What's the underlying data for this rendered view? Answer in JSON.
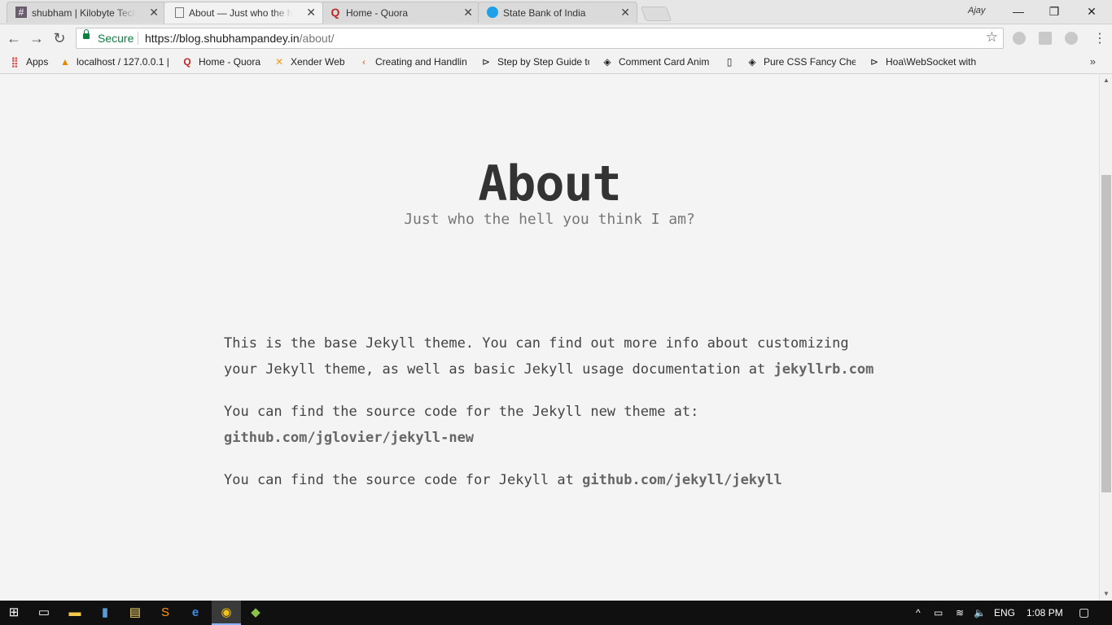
{
  "browser": {
    "tabs": [
      {
        "title": "shubham | Kilobyte Techn",
        "icon": "hash-icon",
        "active": false
      },
      {
        "title": "About — Just who the hell",
        "icon": "page-icon",
        "active": true
      },
      {
        "title": "Home - Quora",
        "icon": "quora-icon",
        "active": false
      },
      {
        "title": "State Bank of India",
        "icon": "sbi-icon",
        "active": false
      }
    ],
    "profile_name": "Ajay",
    "omnibox": {
      "secure_label": "Secure",
      "url_base": "https://blog.shubhampandey.in",
      "url_path": "/about/"
    },
    "bookmarks": [
      {
        "label": "Apps",
        "icon": "apps-grid-icon"
      },
      {
        "label": "localhost / 127.0.0.1 |",
        "icon": "phpmyadmin-icon"
      },
      {
        "label": "Home - Quora",
        "icon": "quora-icon"
      },
      {
        "label": "Xender Web",
        "icon": "xender-icon"
      },
      {
        "label": "Creating and Handlin",
        "icon": "sitepoint-icon"
      },
      {
        "label": "Step by Step Guide to",
        "icon": "codepen-arrow-icon"
      },
      {
        "label": "Comment Card Anim",
        "icon": "codepen-icon"
      },
      {
        "label": "",
        "icon": "blank-page-icon"
      },
      {
        "label": "Pure CSS Fancy Check",
        "icon": "codepen-icon"
      },
      {
        "label": "Hoa\\WebSocket with",
        "icon": "codepen-arrow-icon"
      }
    ]
  },
  "page": {
    "title": "About",
    "subtitle": "Just who the hell you think I am?",
    "p1_text": "This is the base Jekyll theme. You can find out more info about customizing your Jekyll theme, as well as basic Jekyll usage documentation at ",
    "p1_link": "jekyllrb.com",
    "p2_text": "You can find the source code for the Jekyll new theme at: ",
    "p2_link": "github.com/jglovier/jekyll-new",
    "p3_text": "You can find the source code for Jekyll at ",
    "p3_link": "github.com/jekyll/jekyll"
  },
  "taskbar": {
    "language": "ENG",
    "time": "1:08 PM"
  }
}
